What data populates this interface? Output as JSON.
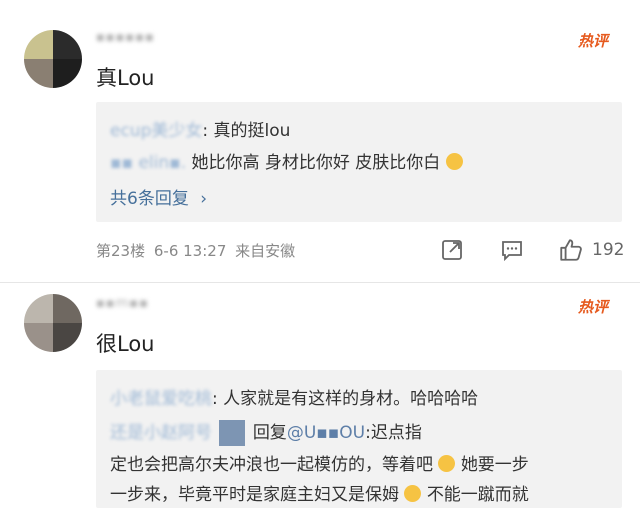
{
  "comments": [
    {
      "username": "▪▪▪▪▪▪",
      "hot_label": "热评",
      "text": "真Lou",
      "replies": [
        {
          "name": "ecup美少女",
          "text": ": 真的挺lou"
        },
        {
          "name": "▪▪ elin▪.",
          "text": " 她比你高 身材比你好 皮肤比你白"
        }
      ],
      "more_replies": "共6条回复",
      "floor": "第23楼",
      "time": "6-6 13:27",
      "source": "来自安徽",
      "likes": "192"
    },
    {
      "username": "▪▪m▪▪",
      "hot_label": "热评",
      "text": "很Lou",
      "replies": [
        {
          "name": "小老鼠爱吃桃",
          "text": ": 人家就是有这样的身材。哈哈哈哈"
        },
        {
          "name": "还是小赵阿号",
          "reply_word": "回复",
          "mention": "@U▪▪OU",
          "text": ":迟点指"
        },
        {
          "text": "定也会把高尔夫冲浪也一起模仿的，等着吧",
          "text2": "她要一步"
        },
        {
          "text": "一步来，毕竟平时是家庭主妇又是保姆",
          "text2": "不能一蹴而就"
        }
      ]
    }
  ],
  "icons": {
    "share": "share-icon",
    "comment": "comment-icon",
    "like": "like-icon",
    "chevron": "chevron-right-icon"
  },
  "colors": {
    "hot": "#e65a1e",
    "link": "#46709b",
    "reply_bg": "#f2f2f2"
  }
}
